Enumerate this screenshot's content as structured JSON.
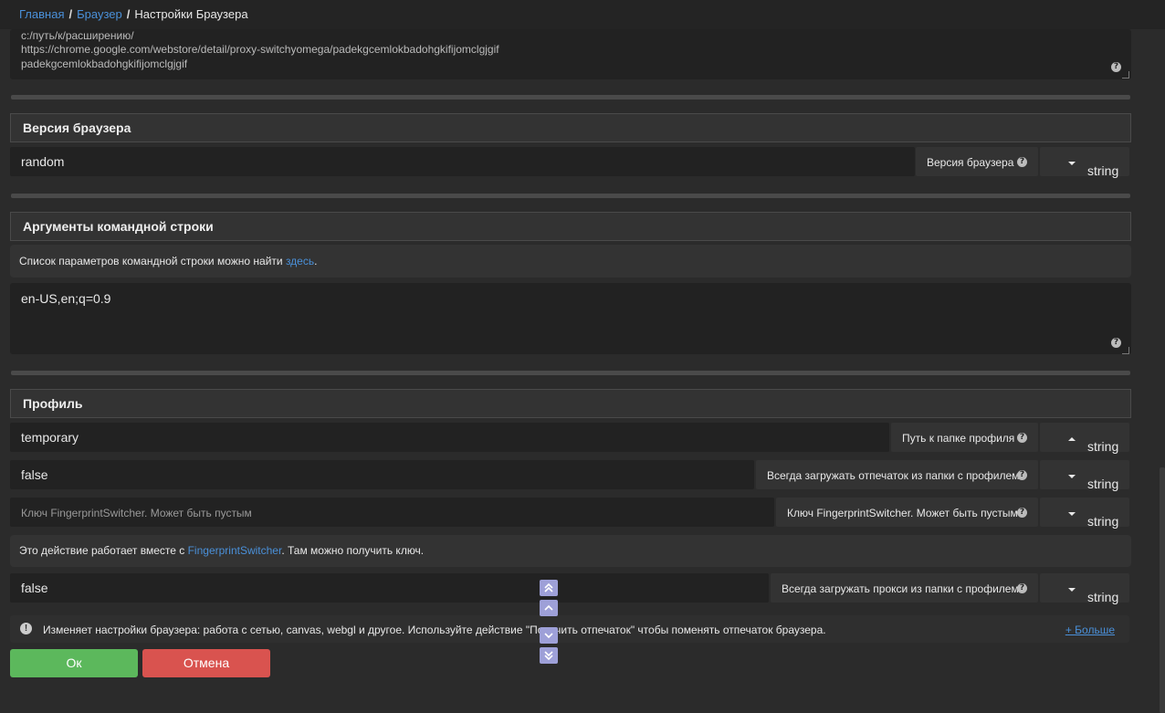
{
  "breadcrumb": {
    "home": "Главная",
    "browser": "Браузер",
    "current": "Настройки Браузера"
  },
  "extensions_textarea": {
    "lines": [
      "c:/путь/к/расширению/",
      "https://chrome.google.com/webstore/detail/proxy-switchyomega/padekgcemlokbadohgkifijomclgjgif",
      "padekgcemlokbadohgkifijomclgjgif"
    ]
  },
  "browser_version": {
    "title": "Версия браузера",
    "value": "random",
    "label": "Версия браузера",
    "type": "string"
  },
  "cmdline": {
    "title": "Аргументы командной строки",
    "info_prefix": "Список параметров командной строки можно найти ",
    "info_link": "здесь",
    "info_suffix": ".",
    "value": "en-US,en;q=0.9"
  },
  "profile": {
    "title": "Профиль",
    "path_value": "temporary",
    "path_label": "Путь к папке профиля",
    "path_type": "string",
    "fingerprint_value": "false",
    "fingerprint_label": "Всегда загружать отпечаток из папки с профилем",
    "fingerprint_type": "string",
    "key_placeholder": "Ключ FingerprintSwitcher. Может быть пустым",
    "key_label": "Ключ FingerprintSwitcher. Может быть пустым",
    "key_type": "string",
    "key_info_prefix": "Это действие работает вместе с ",
    "key_info_link": "FingerprintSwitcher",
    "key_info_suffix": ". Там можно получить ключ.",
    "proxy_value": "false",
    "proxy_label": "Всегда загружать прокси из папки с профилем",
    "proxy_type": "string"
  },
  "bottom": {
    "description": "Изменяет настройки браузера: работа с сетью, canvas, webgl и другое. Используйте действие \"Получить отпечаток\" чтобы поменять отпечаток браузера.",
    "more": "+ Больше"
  },
  "buttons": {
    "ok": "Ок",
    "cancel": "Отмена"
  },
  "icons": {
    "help": "question-circle-icon",
    "warning": "exclamation-circle-icon",
    "nav": [
      "scroll-top-icon",
      "scroll-up-icon",
      "scroll-down-icon",
      "scroll-bottom-icon"
    ]
  },
  "colors": {
    "link": "#4a90d9",
    "ok": "#5cb85c",
    "cancel": "#d9534f",
    "nav": "#9ea0d8"
  }
}
